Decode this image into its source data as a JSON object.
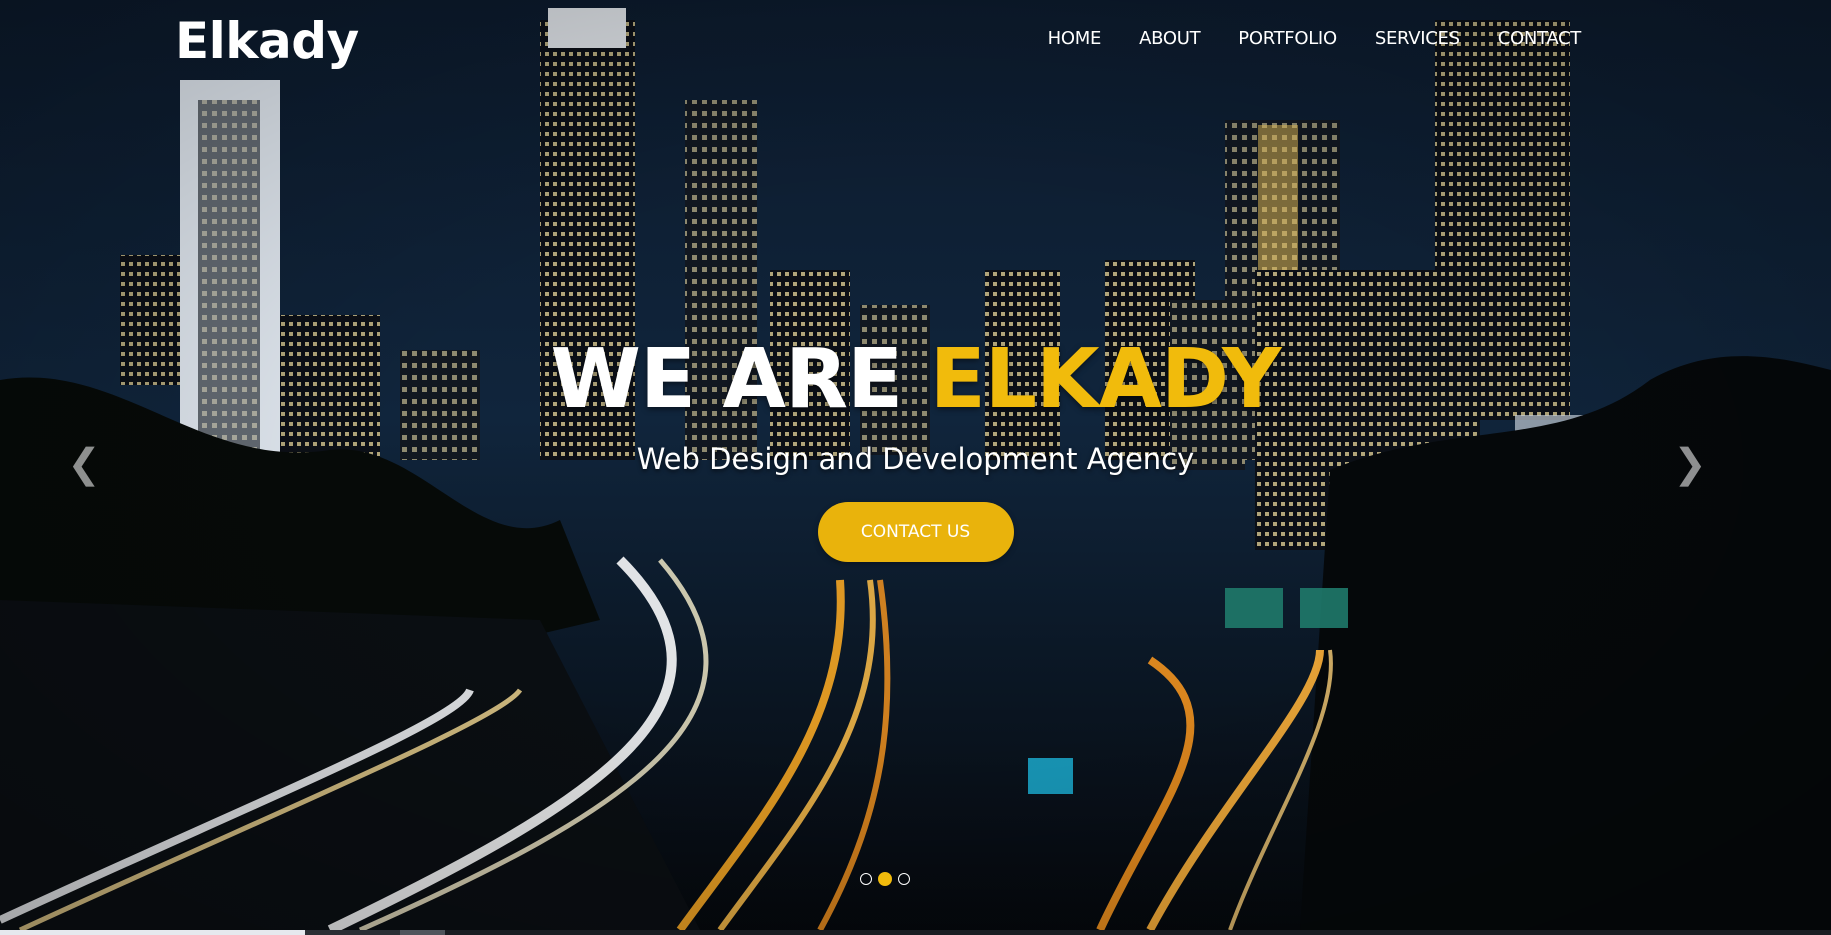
{
  "brand": {
    "name": "Elkady"
  },
  "nav": {
    "items": [
      {
        "label": "HOME"
      },
      {
        "label": "ABOUT"
      },
      {
        "label": "PORTFOLIO"
      },
      {
        "label": "SERVICES"
      },
      {
        "label": "CONTACT"
      }
    ]
  },
  "hero": {
    "headline_part1": "WE ARE",
    "headline_part2": "ELKADY",
    "subheadline": "Web Design and Development Agency",
    "cta_label": "CONTACT US"
  },
  "carousel": {
    "prev_icon": "chevron-left-icon",
    "next_icon": "chevron-right-icon",
    "slide_count": 3,
    "active_slide": 2
  },
  "colors": {
    "accent": "#f1bb0c",
    "button": "#e9b30c",
    "text": "#ffffff"
  }
}
